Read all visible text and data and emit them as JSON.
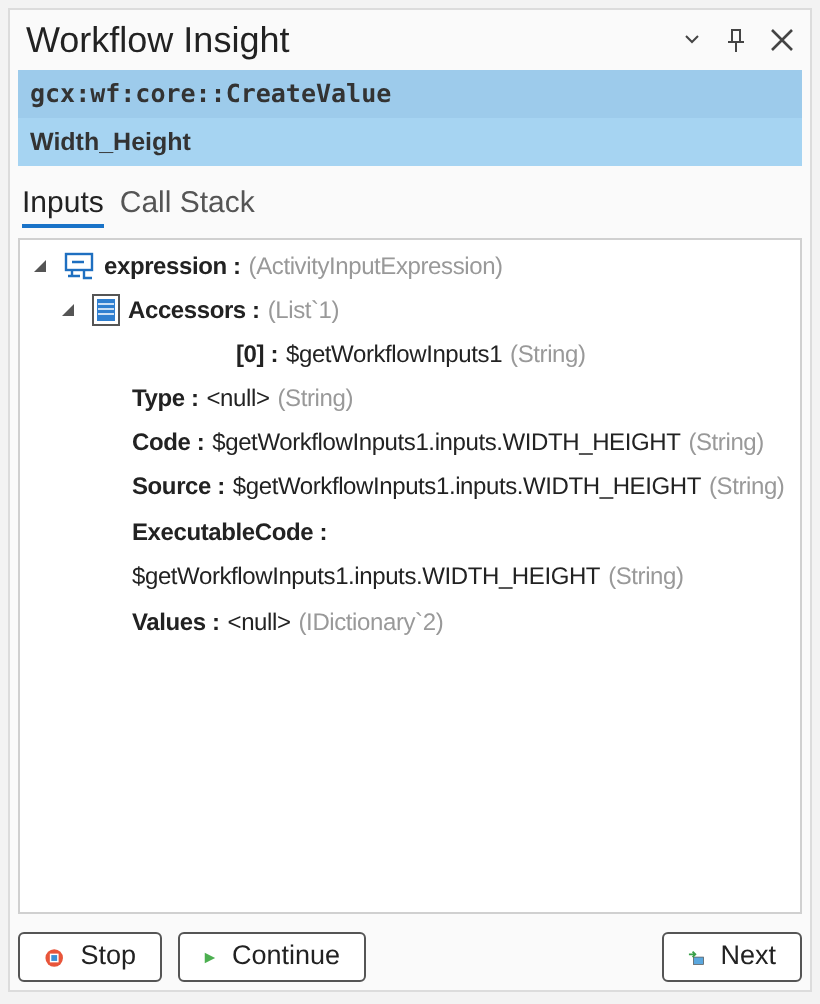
{
  "window": {
    "title": "Workflow Insight"
  },
  "header": {
    "activity": "gcx:wf:core::CreateValue",
    "name": "Width_Height"
  },
  "tabs": [
    {
      "label": "Inputs",
      "selected": true
    },
    {
      "label": "Call Stack",
      "selected": false
    }
  ],
  "tree": [
    {
      "name": "expression :",
      "type": "(ActivityInputExpression)",
      "kind": "workflow",
      "expanded": true,
      "children": [
        {
          "name": "Accessors :",
          "type": "(List`1)",
          "kind": "list",
          "expanded": true,
          "children": [
            {
              "name": "[0] :",
              "value": "$getWorkflowInputs1",
              "type": "(String)",
              "kind": "inline"
            }
          ]
        },
        {
          "name": "Type :",
          "value": "<null>",
          "type": "(String)",
          "kind": "inline"
        },
        {
          "name": "Code :",
          "value": "$getWorkflowInputs1.inputs.WIDTH_HEIGHT",
          "type": "(String)",
          "kind": "inline"
        },
        {
          "name": "Source :",
          "value": "$getWorkflowInputs1.inputs.WIDTH_HEIGHT",
          "type": "(String)",
          "kind": "inline"
        },
        {
          "name": "ExecutableCode :",
          "value": "$getWorkflowInputs1.inputs.WIDTH_HEIGHT",
          "type": "(String)",
          "kind": "wrapped"
        },
        {
          "name": "Values :",
          "value": "<null>",
          "type": "(IDictionary`2)",
          "kind": "inline"
        }
      ]
    }
  ],
  "buttons": [
    {
      "label": "Stop",
      "kind": "stop"
    },
    {
      "label": "Continue",
      "kind": "continue"
    },
    {
      "label": "Next",
      "kind": "next"
    }
  ]
}
